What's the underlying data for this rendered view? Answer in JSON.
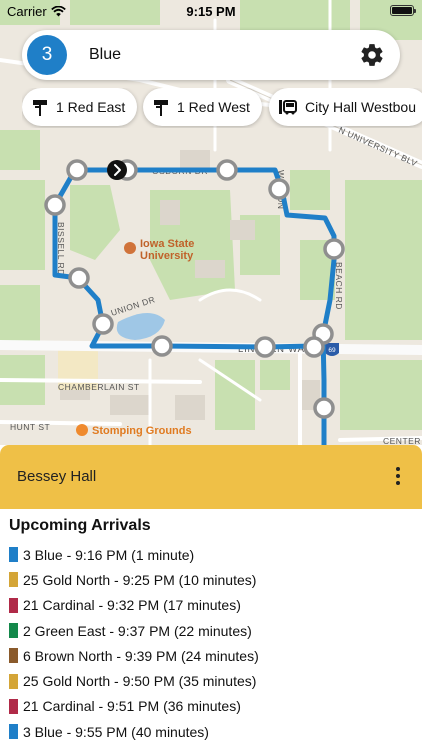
{
  "status_bar": {
    "carrier": "Carrier",
    "time": "9:15 PM"
  },
  "search": {
    "route_number": "3",
    "route_name": "Blue"
  },
  "chips": [
    {
      "label": "1 Red East",
      "icon": "bus-stop-sign-icon"
    },
    {
      "label": "1 Red West",
      "icon": "bus-stop-sign-icon"
    },
    {
      "label": "City Hall Westbou",
      "icon": "bus-icon"
    }
  ],
  "map": {
    "route_color": "#1f7fc8",
    "labels": {
      "north_university_blvd": "N UNIVERSITY BLV",
      "osborn_dr": "OSBORN DR",
      "watson_st": "WATSON",
      "bissell_rd": "BISSELL RD",
      "union_dr": "UNION DR",
      "lincoln_way": "LINCOLN WAY",
      "beach_rd": "BEACH RD",
      "chamberlain_st": "CHAMBERLAIN ST",
      "hunt_st": "HUNT ST",
      "center_rd": "CENTER R",
      "highway_shield": "69"
    },
    "places": {
      "iowa_state": "Iowa State University",
      "stomping_grounds": "Stomping Grounds"
    }
  },
  "selected_stop": {
    "name": "Bessey Hall"
  },
  "arrivals": {
    "title": "Upcoming Arrivals",
    "items": [
      {
        "text": "3 Blue - 9:16 PM (1 minute)",
        "color": "#1f7fc8"
      },
      {
        "text": "25 Gold North - 9:25 PM (10 minutes)",
        "color": "#d4a537"
      },
      {
        "text": "21 Cardinal - 9:32 PM (17 minutes)",
        "color": "#b02a48"
      },
      {
        "text": "2 Green East - 9:37 PM (22 minutes)",
        "color": "#13884a"
      },
      {
        "text": "6 Brown North - 9:39 PM (24 minutes)",
        "color": "#8a5a2b"
      },
      {
        "text": "25 Gold North - 9:50 PM (35 minutes)",
        "color": "#d4a537"
      },
      {
        "text": "21 Cardinal - 9:51 PM (36 minutes)",
        "color": "#b02a48"
      },
      {
        "text": "3 Blue - 9:55 PM (40 minutes)",
        "color": "#1f7fc8"
      }
    ]
  }
}
